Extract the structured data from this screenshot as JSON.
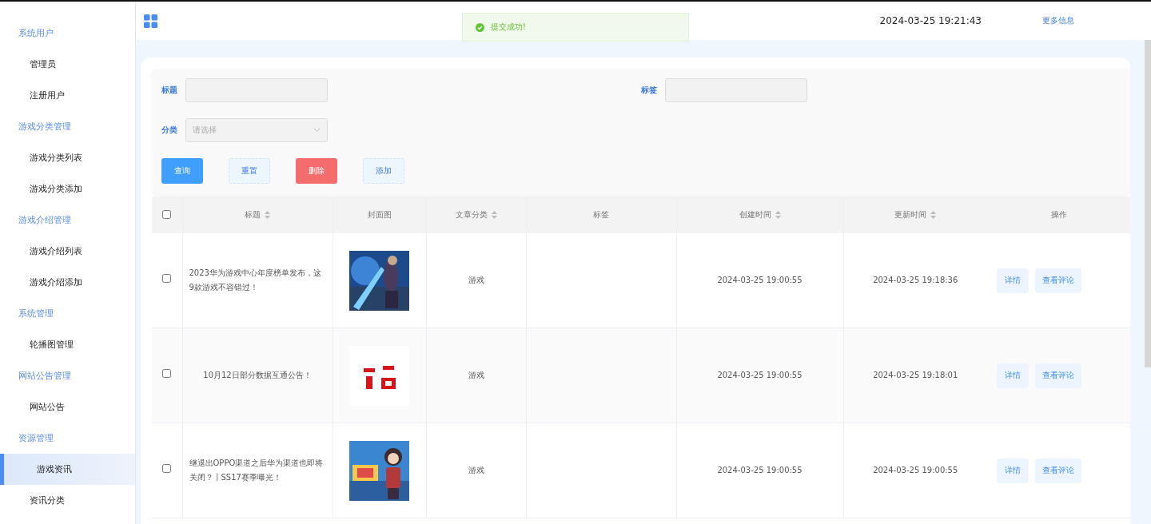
{
  "sidebar": {
    "groups": [
      {
        "title": "系统用户",
        "items": [
          {
            "label": "管理员",
            "selected": false
          },
          {
            "label": "注册用户",
            "selected": false
          }
        ]
      },
      {
        "title": "游戏分类管理",
        "items": [
          {
            "label": "游戏分类列表",
            "selected": false
          },
          {
            "label": "游戏分类添加",
            "selected": false
          }
        ]
      },
      {
        "title": "游戏介绍管理",
        "items": [
          {
            "label": "游戏介绍列表",
            "selected": false
          },
          {
            "label": "游戏介绍添加",
            "selected": false
          }
        ]
      },
      {
        "title": "系统管理",
        "items": [
          {
            "label": "轮播图管理",
            "selected": false
          }
        ]
      },
      {
        "title": "网站公告管理",
        "items": [
          {
            "label": "网站公告",
            "selected": false
          }
        ]
      },
      {
        "title": "资源管理",
        "items": [
          {
            "label": "游戏资讯",
            "selected": true
          },
          {
            "label": "资讯分类",
            "selected": false
          }
        ]
      }
    ]
  },
  "header": {
    "datetime": "2024-03-25 19:21:43",
    "more_link": "更多信息"
  },
  "toast": {
    "message": "提交成功!"
  },
  "filters": {
    "fields": [
      {
        "label": "标题",
        "kind": "input"
      },
      {
        "label": "标签",
        "kind": "input"
      },
      {
        "label": "分类",
        "kind": "select",
        "placeholder": "请选择"
      }
    ],
    "buttons": [
      {
        "label": "查询",
        "kind": "primary"
      },
      {
        "label": "重置",
        "kind": "plain"
      },
      {
        "label": "删除",
        "kind": "danger"
      },
      {
        "label": "添加",
        "kind": "plain"
      }
    ]
  },
  "table": {
    "all_checked": false,
    "columns": [
      {
        "label": "标题",
        "sortable": true
      },
      {
        "label": "封面图",
        "sortable": false
      },
      {
        "label": "文章分类",
        "sortable": true
      },
      {
        "label": "标签",
        "sortable": false
      },
      {
        "label": "创建时间",
        "sortable": true
      },
      {
        "label": "更新时间",
        "sortable": true
      },
      {
        "label": "操作",
        "sortable": false
      }
    ],
    "rows": [
      {
        "checked": false,
        "title": "2023华为游戏中心年度榜单发布，这9款游戏不容错过！",
        "cover": {
          "kind": "picture"
        },
        "category": "游戏",
        "created": "2024-03-25 19:00:55",
        "updated": "2024-03-25 19:18:36",
        "actions": [
          "详情",
          "查看评论"
        ]
      },
      {
        "checked": false,
        "title": "10月12日部分数据互通公告！",
        "cover": {
          "kind": "picture"
        },
        "category": "游戏",
        "created": "2024-03-25 19:00:55",
        "updated": "2024-03-25 19:18:01",
        "actions": [
          "详情",
          "查看评论"
        ]
      },
      {
        "checked": false,
        "title": "继退出OPPO渠道之后华为渠道也即将关闭？丨SS17赛季曝光！",
        "cover": {
          "kind": "picture"
        },
        "category": "游戏",
        "created": "2024-03-25 19:00:55",
        "updated": "2024-03-25 19:00:55",
        "actions": [
          "详情",
          "查看评论"
        ]
      }
    ]
  }
}
